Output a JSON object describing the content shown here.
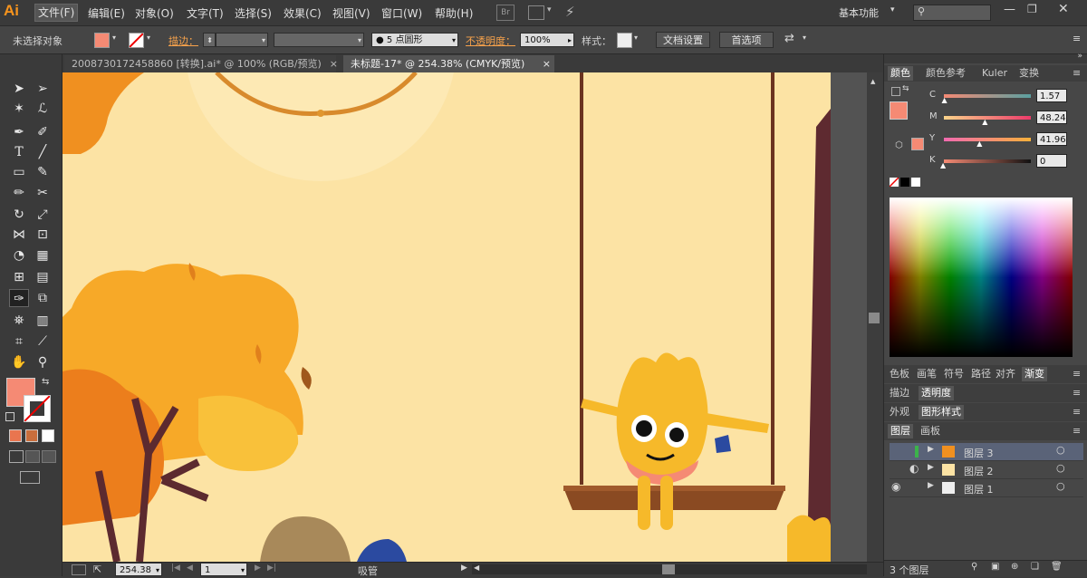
{
  "app": {
    "logo": "Ai"
  },
  "menu": {
    "items": [
      "文件(F)",
      "编辑(E)",
      "对象(O)",
      "文字(T)",
      "选择(S)",
      "效果(C)",
      "视图(V)",
      "窗口(W)",
      "帮助(H)"
    ],
    "workspace": "基本功能",
    "br_label": "Br"
  },
  "control": {
    "selection_status": "未选择对象",
    "stroke_label": "描边：",
    "brush_value": "5 点圆形",
    "opacity_label": "不透明度：",
    "opacity_value": "100%",
    "style_label": "样式：",
    "doc_settings": "文档设置",
    "preferences": "首选项"
  },
  "tabs": [
    {
      "label": "2008730172458860 [转换].ai* @ 100% (RGB/预览)",
      "close": "×"
    },
    {
      "label": "未标题-17* @ 254.38% (CMYK/预览)",
      "close": "×"
    }
  ],
  "status": {
    "zoom": "254.38",
    "artboard": "1",
    "tool_name": "吸管"
  },
  "color_panel": {
    "tabs": [
      "颜色",
      "颜色参考",
      "Kuler",
      "变换"
    ],
    "channels": [
      {
        "label": "C",
        "value": "1.57",
        "fraction": 0.0157
      },
      {
        "label": "M",
        "value": "48.24",
        "fraction": 0.4824
      },
      {
        "label": "Y",
        "value": "41.96",
        "fraction": 0.4196
      },
      {
        "label": "K",
        "value": "0",
        "fraction": 0
      }
    ],
    "fill_color": "#f58a74"
  },
  "panels_row1": [
    "色板",
    "画笔",
    "符号",
    "路径",
    "对齐",
    "渐变"
  ],
  "panels_row2": [
    "描边",
    "透明度"
  ],
  "panels_row3": [
    "外观",
    "图形样式"
  ],
  "layers_panel": {
    "tabs": [
      "图层",
      "画板"
    ],
    "layers": [
      {
        "name": "图层 3",
        "selected": true
      },
      {
        "name": "图层 2",
        "selected": false
      },
      {
        "name": "图层 1",
        "selected": false
      }
    ],
    "count": "3 个图层"
  },
  "colors": {
    "accent_orange": "#f7941d",
    "fill": "#f58a74",
    "canvas_bg": "#fce3a4"
  }
}
